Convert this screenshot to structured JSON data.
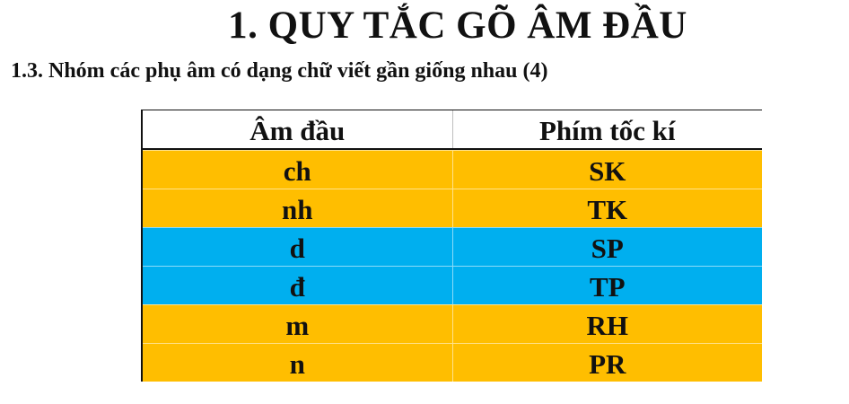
{
  "heading": {
    "title": "1. QUY TẮC GÕ ÂM ĐẦU",
    "subtitle": "1.3. Nhóm các phụ âm có dạng chữ viết gần giống nhau (4)"
  },
  "table": {
    "headers": [
      "Âm đầu",
      "Phím tốc kí"
    ],
    "rows": [
      {
        "am_dau": "ch",
        "phim": "SK",
        "color": "#FFBE00"
      },
      {
        "am_dau": "nh",
        "phim": "TK",
        "color": "#FFBE00"
      },
      {
        "am_dau": "d",
        "phim": "SP",
        "color": "#00AFEF"
      },
      {
        "am_dau": "đ",
        "phim": "TP",
        "color": "#00AFEF"
      },
      {
        "am_dau": "m",
        "phim": "RH",
        "color": "#FFBE00"
      },
      {
        "am_dau": "n",
        "phim": "PR",
        "color": "#FFBE00"
      }
    ]
  }
}
